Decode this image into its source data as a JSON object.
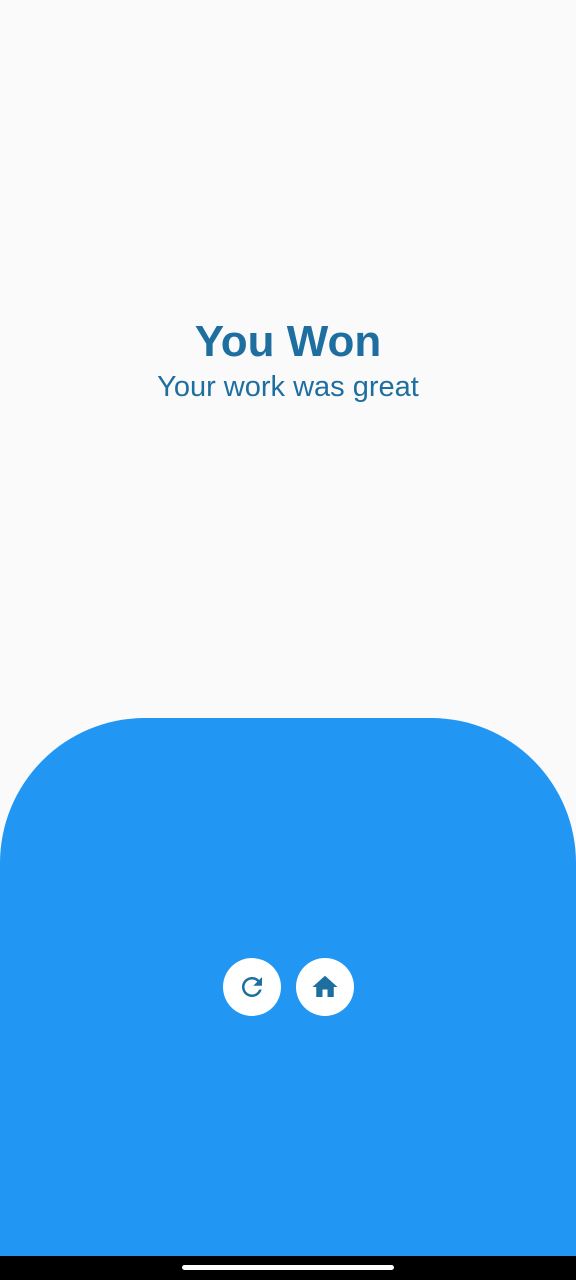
{
  "result": {
    "title": "You Won",
    "subtitle": "Your work was great"
  },
  "actions": [
    {
      "icon": "refresh-icon"
    },
    {
      "icon": "home-icon"
    }
  ],
  "colors": {
    "background": "#FAFAFA",
    "accent_text": "#1E6FA0",
    "panel": "#2196F3",
    "button": "#FFFFFF"
  }
}
